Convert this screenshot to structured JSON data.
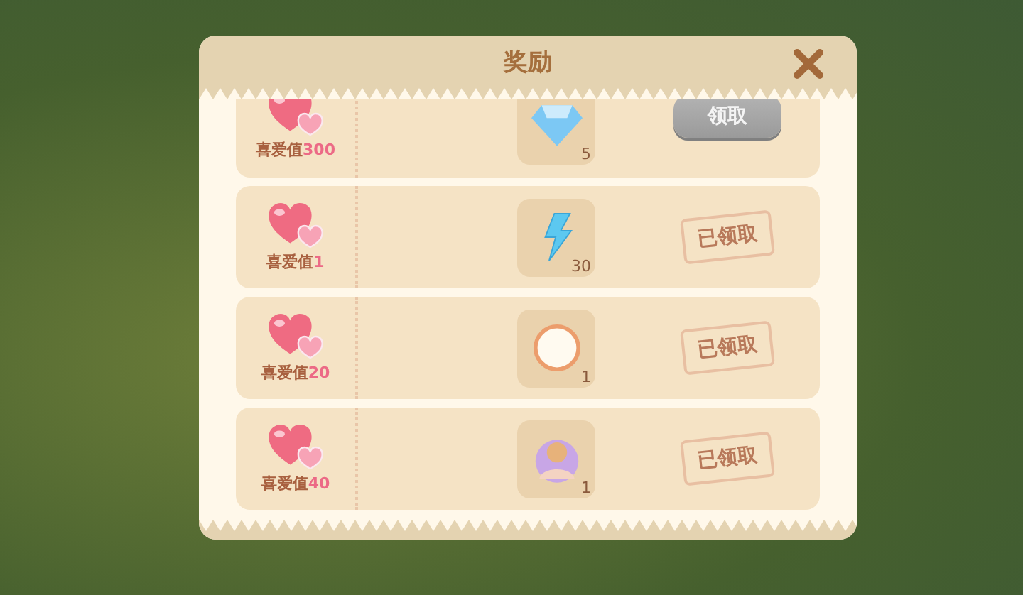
{
  "dialog": {
    "title": "奖励"
  },
  "rewards": [
    {
      "label": "喜爱值",
      "value": "300",
      "item": {
        "kind": "diamond",
        "count": "5"
      },
      "claimed": false,
      "action": "领取"
    },
    {
      "label": "喜爱值",
      "value": "1",
      "item": {
        "kind": "lightning",
        "count": "30"
      },
      "claimed": true,
      "action": "已领取"
    },
    {
      "label": "喜爱值",
      "value": "20",
      "item": {
        "kind": "ring",
        "count": "1"
      },
      "claimed": true,
      "action": "已领取"
    },
    {
      "label": "喜爱值",
      "value": "40",
      "item": {
        "kind": "portrait",
        "count": "1"
      },
      "claimed": true,
      "action": "已领取"
    }
  ]
}
